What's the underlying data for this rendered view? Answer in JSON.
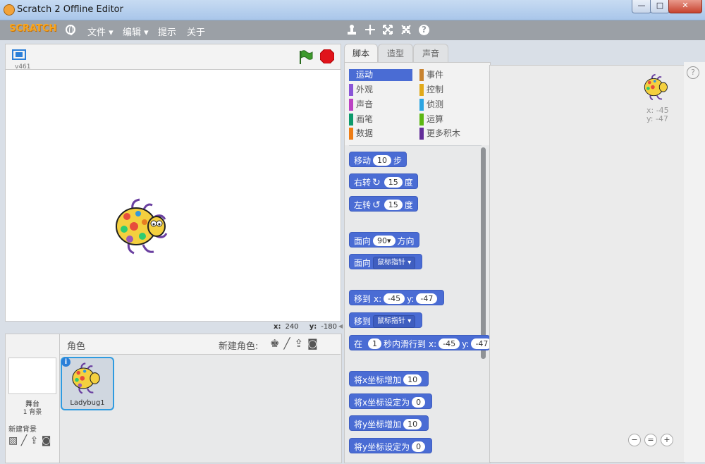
{
  "window": {
    "title": "Scratch 2 Offline Editor",
    "min": "—",
    "max": "□",
    "close": "✕"
  },
  "menu": {
    "logo": "SCRATCH",
    "file": "文件 ▾",
    "edit": "编辑 ▾",
    "tips": "提示",
    "about": "关于"
  },
  "toolbar": {
    "duplicate_icon": "person-stamp-icon",
    "cut_icon": "cut-icon",
    "grow_icon": "grow-icon",
    "shrink_icon": "shrink-icon",
    "help_icon": "?"
  },
  "stage": {
    "version": "v461",
    "coords": {
      "x_label": "x:",
      "x": "240",
      "y_label": "y:",
      "y": "-180"
    }
  },
  "sprite_pane": {
    "sprites_title": "角色",
    "new_sprite_label": "新建角色:",
    "stage_label": "舞台",
    "backdrop_count": "1 背景",
    "new_backdrop_label": "新建背景",
    "sprite_name": "Ladybug1",
    "info_icon": "i"
  },
  "tabs": {
    "scripts": "脚本",
    "costumes": "造型",
    "sounds": "声音"
  },
  "categories": [
    {
      "label": "运动",
      "color": "#4a6cd4"
    },
    {
      "label": "外观",
      "color": "#8a55d7"
    },
    {
      "label": "声音",
      "color": "#bb42c3"
    },
    {
      "label": "画笔",
      "color": "#0e9a6c"
    },
    {
      "label": "数据",
      "color": "#ee7d16"
    },
    {
      "label": "事件",
      "color": "#c88330"
    },
    {
      "label": "控制",
      "color": "#e1a91a"
    },
    {
      "label": "侦测",
      "color": "#2ca5e2"
    },
    {
      "label": "运算",
      "color": "#5cb712"
    },
    {
      "label": "更多积木",
      "color": "#632d99"
    }
  ],
  "blocks": {
    "move": {
      "a": "移动",
      "n": "10",
      "b": "步"
    },
    "turn_right": {
      "a": "右转",
      "n": "15",
      "b": "度"
    },
    "turn_left": {
      "a": "左转",
      "n": "15",
      "b": "度"
    },
    "point_dir": {
      "a": "面向",
      "n": "90▾",
      "b": "方向"
    },
    "point_towards": {
      "a": "面向",
      "d": "鼠标指针 ▾"
    },
    "goto_xy": {
      "a": "移到",
      "xl": "x:",
      "x": "-45",
      "yl": "y:",
      "y": "-47"
    },
    "goto": {
      "a": "移到",
      "d": "鼠标指针 ▾"
    },
    "glide": {
      "a": "在",
      "n": "1",
      "b": "秒内滑行到",
      "xl": "x:",
      "x": "-45",
      "yl": "y:",
      "y": "-47"
    },
    "change_x": {
      "a": "将x坐标增加",
      "n": "10"
    },
    "set_x": {
      "a": "将x坐标设定为",
      "n": "0"
    },
    "change_y": {
      "a": "将y坐标增加",
      "n": "10"
    },
    "set_y": {
      "a": "将y坐标设定为",
      "n": "0"
    }
  },
  "script_area": {
    "x": "x: -45",
    "y": "y: -47",
    "zoom_out": "−",
    "zoom_reset": "=",
    "zoom_in": "+"
  },
  "help": "?"
}
